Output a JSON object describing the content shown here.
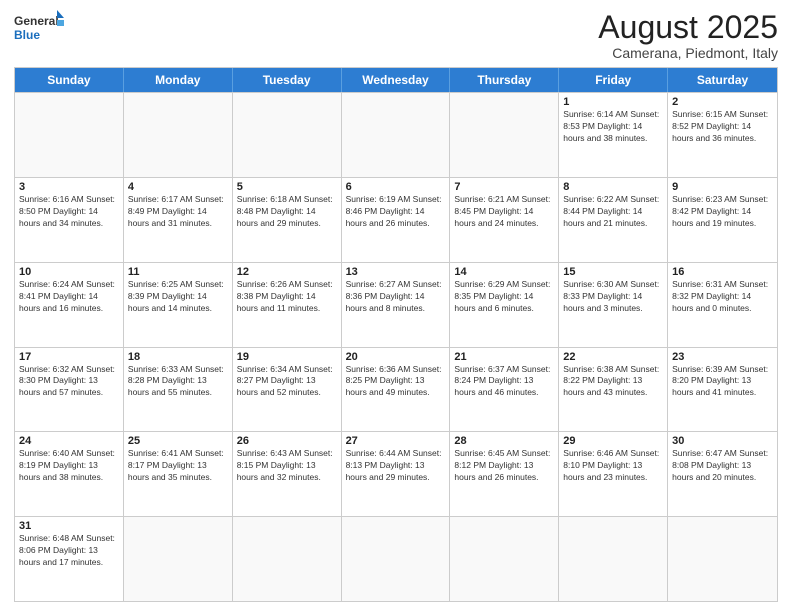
{
  "header": {
    "logo_general": "General",
    "logo_blue": "Blue",
    "month_year": "August 2025",
    "location": "Camerana, Piedmont, Italy"
  },
  "days_of_week": [
    "Sunday",
    "Monday",
    "Tuesday",
    "Wednesday",
    "Thursday",
    "Friday",
    "Saturday"
  ],
  "weeks": [
    [
      {
        "day": "",
        "info": ""
      },
      {
        "day": "",
        "info": ""
      },
      {
        "day": "",
        "info": ""
      },
      {
        "day": "",
        "info": ""
      },
      {
        "day": "",
        "info": ""
      },
      {
        "day": "1",
        "info": "Sunrise: 6:14 AM\nSunset: 8:53 PM\nDaylight: 14 hours and 38 minutes."
      },
      {
        "day": "2",
        "info": "Sunrise: 6:15 AM\nSunset: 8:52 PM\nDaylight: 14 hours and 36 minutes."
      }
    ],
    [
      {
        "day": "3",
        "info": "Sunrise: 6:16 AM\nSunset: 8:50 PM\nDaylight: 14 hours and 34 minutes."
      },
      {
        "day": "4",
        "info": "Sunrise: 6:17 AM\nSunset: 8:49 PM\nDaylight: 14 hours and 31 minutes."
      },
      {
        "day": "5",
        "info": "Sunrise: 6:18 AM\nSunset: 8:48 PM\nDaylight: 14 hours and 29 minutes."
      },
      {
        "day": "6",
        "info": "Sunrise: 6:19 AM\nSunset: 8:46 PM\nDaylight: 14 hours and 26 minutes."
      },
      {
        "day": "7",
        "info": "Sunrise: 6:21 AM\nSunset: 8:45 PM\nDaylight: 14 hours and 24 minutes."
      },
      {
        "day": "8",
        "info": "Sunrise: 6:22 AM\nSunset: 8:44 PM\nDaylight: 14 hours and 21 minutes."
      },
      {
        "day": "9",
        "info": "Sunrise: 6:23 AM\nSunset: 8:42 PM\nDaylight: 14 hours and 19 minutes."
      }
    ],
    [
      {
        "day": "10",
        "info": "Sunrise: 6:24 AM\nSunset: 8:41 PM\nDaylight: 14 hours and 16 minutes."
      },
      {
        "day": "11",
        "info": "Sunrise: 6:25 AM\nSunset: 8:39 PM\nDaylight: 14 hours and 14 minutes."
      },
      {
        "day": "12",
        "info": "Sunrise: 6:26 AM\nSunset: 8:38 PM\nDaylight: 14 hours and 11 minutes."
      },
      {
        "day": "13",
        "info": "Sunrise: 6:27 AM\nSunset: 8:36 PM\nDaylight: 14 hours and 8 minutes."
      },
      {
        "day": "14",
        "info": "Sunrise: 6:29 AM\nSunset: 8:35 PM\nDaylight: 14 hours and 6 minutes."
      },
      {
        "day": "15",
        "info": "Sunrise: 6:30 AM\nSunset: 8:33 PM\nDaylight: 14 hours and 3 minutes."
      },
      {
        "day": "16",
        "info": "Sunrise: 6:31 AM\nSunset: 8:32 PM\nDaylight: 14 hours and 0 minutes."
      }
    ],
    [
      {
        "day": "17",
        "info": "Sunrise: 6:32 AM\nSunset: 8:30 PM\nDaylight: 13 hours and 57 minutes."
      },
      {
        "day": "18",
        "info": "Sunrise: 6:33 AM\nSunset: 8:28 PM\nDaylight: 13 hours and 55 minutes."
      },
      {
        "day": "19",
        "info": "Sunrise: 6:34 AM\nSunset: 8:27 PM\nDaylight: 13 hours and 52 minutes."
      },
      {
        "day": "20",
        "info": "Sunrise: 6:36 AM\nSunset: 8:25 PM\nDaylight: 13 hours and 49 minutes."
      },
      {
        "day": "21",
        "info": "Sunrise: 6:37 AM\nSunset: 8:24 PM\nDaylight: 13 hours and 46 minutes."
      },
      {
        "day": "22",
        "info": "Sunrise: 6:38 AM\nSunset: 8:22 PM\nDaylight: 13 hours and 43 minutes."
      },
      {
        "day": "23",
        "info": "Sunrise: 6:39 AM\nSunset: 8:20 PM\nDaylight: 13 hours and 41 minutes."
      }
    ],
    [
      {
        "day": "24",
        "info": "Sunrise: 6:40 AM\nSunset: 8:19 PM\nDaylight: 13 hours and 38 minutes."
      },
      {
        "day": "25",
        "info": "Sunrise: 6:41 AM\nSunset: 8:17 PM\nDaylight: 13 hours and 35 minutes."
      },
      {
        "day": "26",
        "info": "Sunrise: 6:43 AM\nSunset: 8:15 PM\nDaylight: 13 hours and 32 minutes."
      },
      {
        "day": "27",
        "info": "Sunrise: 6:44 AM\nSunset: 8:13 PM\nDaylight: 13 hours and 29 minutes."
      },
      {
        "day": "28",
        "info": "Sunrise: 6:45 AM\nSunset: 8:12 PM\nDaylight: 13 hours and 26 minutes."
      },
      {
        "day": "29",
        "info": "Sunrise: 6:46 AM\nSunset: 8:10 PM\nDaylight: 13 hours and 23 minutes."
      },
      {
        "day": "30",
        "info": "Sunrise: 6:47 AM\nSunset: 8:08 PM\nDaylight: 13 hours and 20 minutes."
      }
    ],
    [
      {
        "day": "31",
        "info": "Sunrise: 6:48 AM\nSunset: 8:06 PM\nDaylight: 13 hours and 17 minutes."
      },
      {
        "day": "",
        "info": ""
      },
      {
        "day": "",
        "info": ""
      },
      {
        "day": "",
        "info": ""
      },
      {
        "day": "",
        "info": ""
      },
      {
        "day": "",
        "info": ""
      },
      {
        "day": "",
        "info": ""
      }
    ]
  ]
}
